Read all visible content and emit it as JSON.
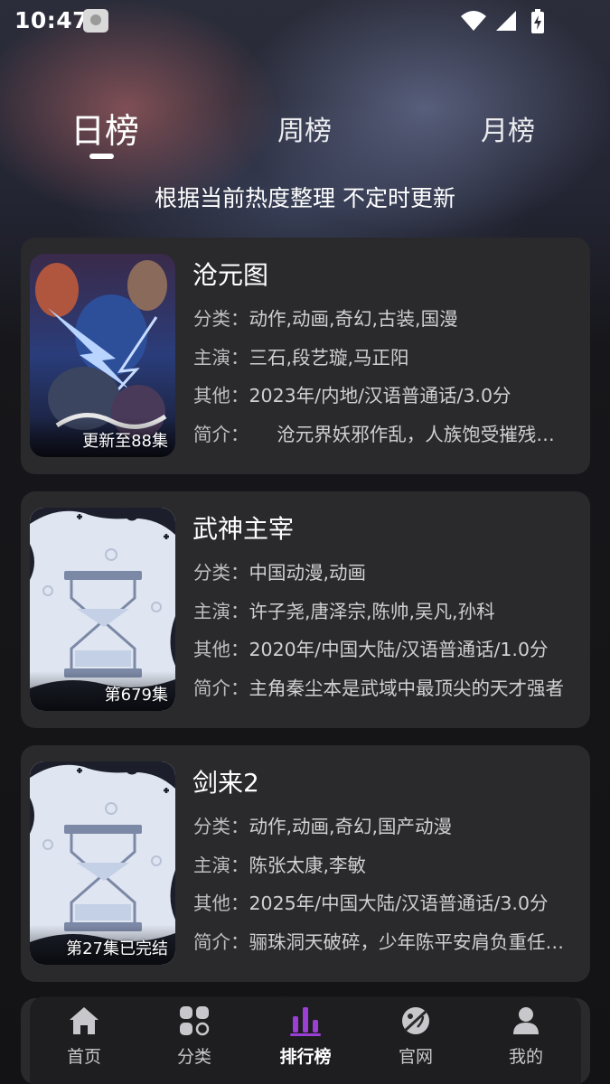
{
  "status_bar": {
    "time": "10:47",
    "icons": [
      "wifi-icon",
      "signal-icon",
      "battery-icon"
    ]
  },
  "tabs": [
    {
      "label": "日榜",
      "active": true
    },
    {
      "label": "周榜",
      "active": false
    },
    {
      "label": "月榜",
      "active": false
    }
  ],
  "subtitle": "根据当前热度整理 不定时更新",
  "labels": {
    "category": "分类：",
    "cast": "主演：",
    "other": "其他：",
    "intro": "简介："
  },
  "items": [
    {
      "title": "沧元图",
      "category": "动作,动画,奇幻,古装,国漫",
      "cast": "三石,段艺璇,马正阳",
      "other": "2023年/内地/汉语普通话/3.0分",
      "intro": "　　沧元界妖邪作乱，人族饱受摧残，人族少年",
      "badge": "更新至88集",
      "poster": "artwork"
    },
    {
      "title": "武神主宰",
      "category": "中国动漫,动画",
      "cast": "许子尧,唐泽宗,陈帅,吴凡,孙科",
      "other": "2020年/中国大陆/汉语普通话/1.0分",
      "intro": "主角秦尘本是武域中最顶尖的天才强者",
      "badge": "第679集",
      "poster": "hourglass-placeholder"
    },
    {
      "title": "剑来2",
      "category": "动作,动画,奇幻,国产动漫",
      "cast": "陈张太康,李敏",
      "other": "2025年/中国大陆/汉语普通话/3.0分",
      "intro": "骊珠洞天破碎，少年陈平安肩负重任踏上旅途",
      "badge": "第27集已完结",
      "poster": "hourglass-placeholder"
    }
  ],
  "bottom_nav": [
    {
      "label": "首页",
      "icon": "home-icon",
      "active": false
    },
    {
      "label": "分类",
      "icon": "category-icon",
      "active": false
    },
    {
      "label": "排行榜",
      "icon": "ranking-icon",
      "active": true
    },
    {
      "label": "官网",
      "icon": "website-icon",
      "active": false
    },
    {
      "label": "我的",
      "icon": "profile-icon",
      "active": false
    }
  ],
  "colors": {
    "accent": "#9b3fd6",
    "card": "#2a2a2c",
    "text_secondary": "#d0d0d4"
  }
}
